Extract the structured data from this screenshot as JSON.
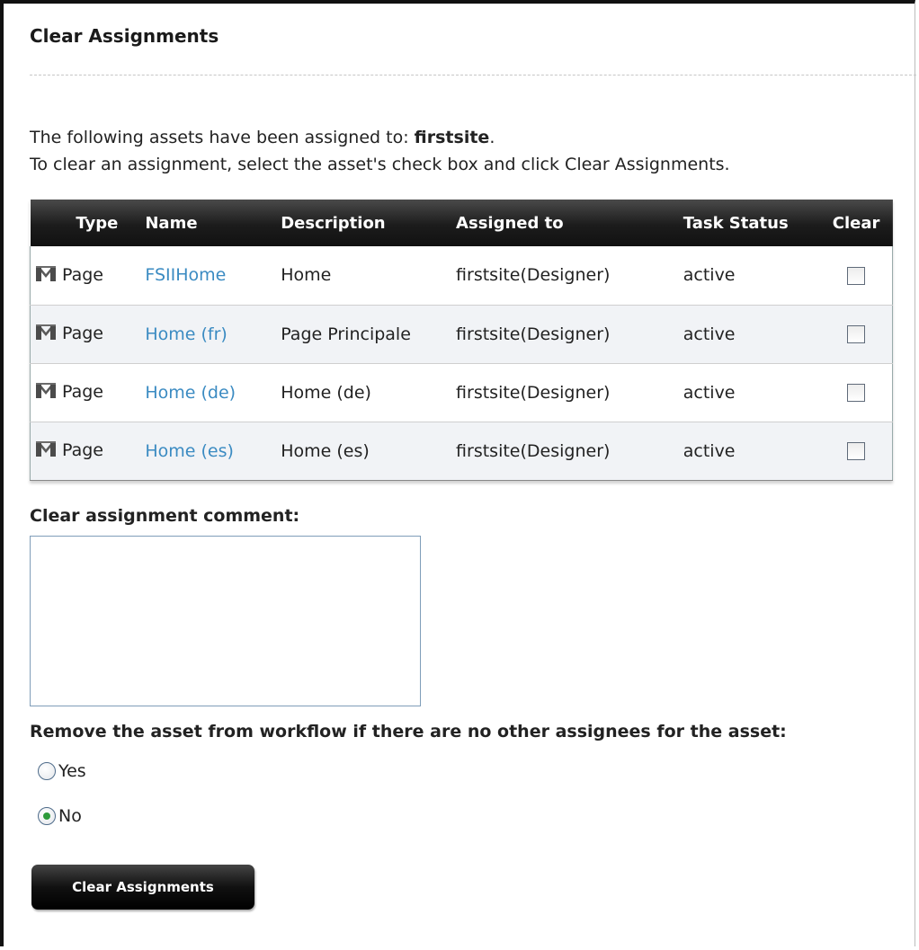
{
  "page": {
    "title": "Clear Assignments",
    "intro_prefix": "The following assets have been assigned to: ",
    "assignee": "firstsite",
    "intro_suffix": ".",
    "instructions": "To clear an assignment, select the asset's check box and click Clear Assignments."
  },
  "table": {
    "headers": {
      "type": "Type",
      "name": "Name",
      "description": "Description",
      "assigned_to": "Assigned to",
      "task_status": "Task Status",
      "clear": "Clear"
    },
    "rows": [
      {
        "type": "Page",
        "icon": "page-type-icon",
        "name": "FSIIHome",
        "description": "Home",
        "assigned_to": "firstsite(Designer)",
        "status": "active",
        "clear": false
      },
      {
        "type": "Page",
        "icon": "page-type-icon",
        "name": "Home (fr)",
        "description": "Page Principale",
        "assigned_to": "firstsite(Designer)",
        "status": "active",
        "clear": false
      },
      {
        "type": "Page",
        "icon": "page-type-icon",
        "name": "Home (de)",
        "description": "Home (de)",
        "assigned_to": "firstsite(Designer)",
        "status": "active",
        "clear": false
      },
      {
        "type": "Page",
        "icon": "page-type-icon",
        "name": "Home (es)",
        "description": "Home (es)",
        "assigned_to": "firstsite(Designer)",
        "status": "active",
        "clear": false
      }
    ]
  },
  "form": {
    "comment_label": "Clear assignment comment:",
    "comment_value": "",
    "remove_label": "Remove the asset from workflow if there are no other assignees for the asset:",
    "options": [
      {
        "label": "Yes",
        "selected": false
      },
      {
        "label": "No",
        "selected": true
      }
    ],
    "submit_label": "Clear Assignments"
  },
  "colors": {
    "link": "#3b8bc2",
    "header_bg": "#1c1c1c",
    "radio_selected": "#2d9a3a"
  }
}
